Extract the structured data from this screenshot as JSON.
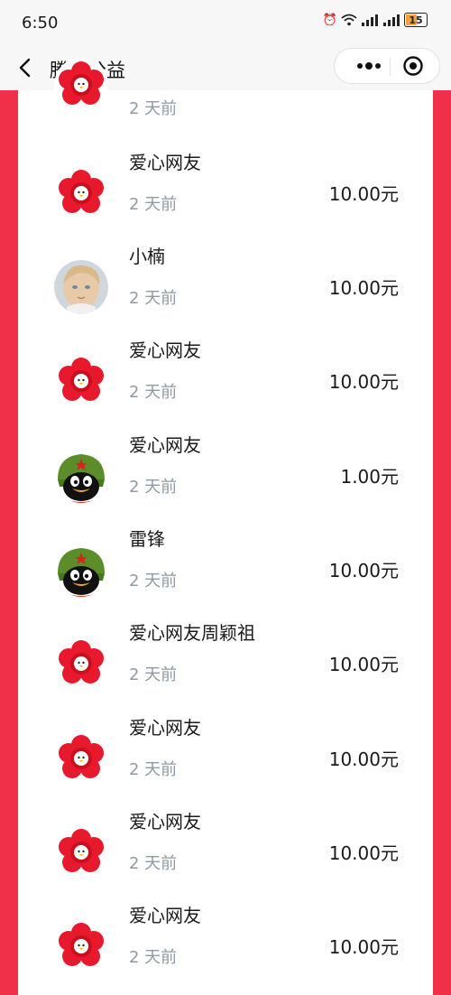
{
  "status": {
    "time": "6:50",
    "battery": "15"
  },
  "nav": {
    "title": "腾讯公益"
  },
  "top_partial": {
    "time": "2 天前"
  },
  "donations": [
    {
      "name": "爱心网友",
      "time": "2 天前",
      "amount": "10.00元",
      "avatar": "red-flower"
    },
    {
      "name": "小楠",
      "time": "2 天前",
      "amount": "10.00元",
      "avatar": "child-photo"
    },
    {
      "name": "爱心网友",
      "time": "2 天前",
      "amount": "10.00元",
      "avatar": "red-flower"
    },
    {
      "name": "爱心网友",
      "time": "2 天前",
      "amount": "1.00元",
      "avatar": "qq-penguin"
    },
    {
      "name": "雷锋",
      "time": "2 天前",
      "amount": "10.00元",
      "avatar": "qq-penguin"
    },
    {
      "name": "爱心网友周颖祖",
      "time": "2 天前",
      "amount": "10.00元",
      "avatar": "red-flower"
    },
    {
      "name": "爱心网友",
      "time": "2 天前",
      "amount": "10.00元",
      "avatar": "red-flower"
    },
    {
      "name": "爱心网友",
      "time": "2 天前",
      "amount": "10.00元",
      "avatar": "red-flower"
    },
    {
      "name": "爱心网友",
      "time": "2 天前",
      "amount": "10.00元",
      "avatar": "red-flower"
    }
  ],
  "colors": {
    "side_bar": "#f03048",
    "time_text": "#8f9aa3",
    "flower": "#e8192c"
  }
}
